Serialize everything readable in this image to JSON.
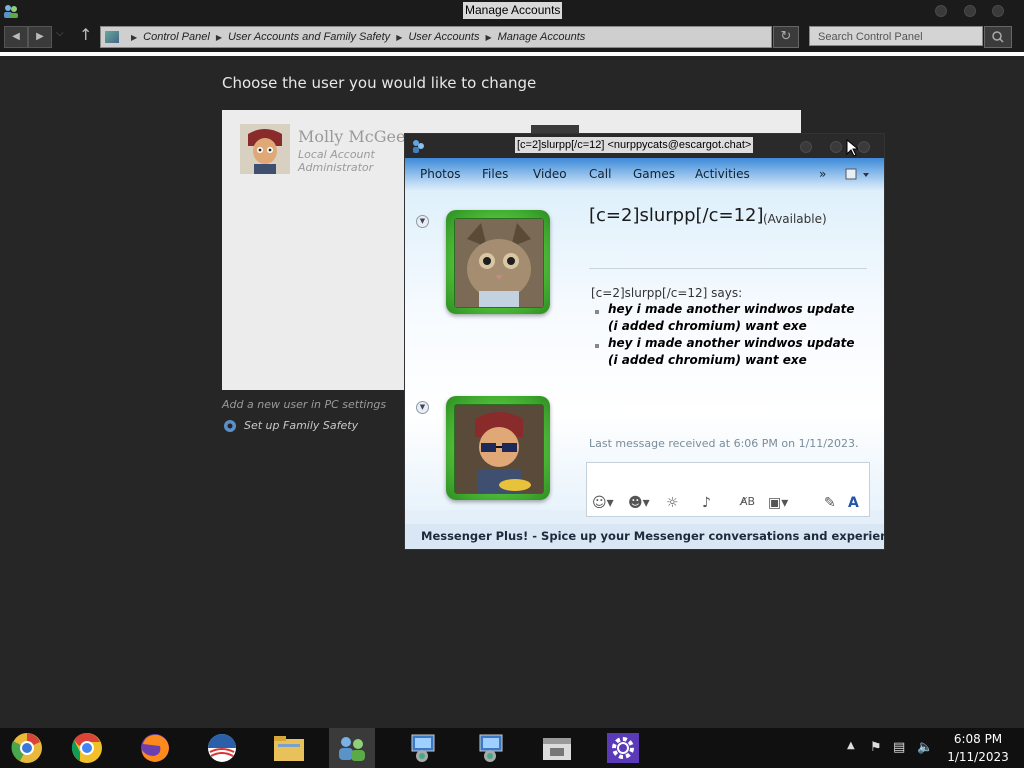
{
  "window": {
    "title": "Manage Accounts"
  },
  "address": {
    "crumbs": [
      "Control Panel",
      "User Accounts and Family Safety",
      "User Accounts",
      "Manage Accounts"
    ],
    "search_placeholder": "Search Control Panel"
  },
  "main": {
    "heading": "Choose the user you would like to change",
    "account": {
      "name": "Molly McGee",
      "type": "Local Account",
      "role": "Administrator"
    },
    "add_user_link": "Add a new user in PC settings",
    "family_safety_link": "Set up Family Safety"
  },
  "messenger": {
    "title": "[c=2]slurpp[/c=12] <nurppycats@escargot.chat>",
    "toolbar": [
      "Photos",
      "Files",
      "Video",
      "Call",
      "Games",
      "Activities"
    ],
    "more_label": "»",
    "contact_name": "[c=2]slurpp[/c=12]",
    "contact_status": "(Available)",
    "says_line": "[c=2]slurpp[/c=12] says:",
    "messages": [
      "hey i made another windwos update (i added chromium) want exe",
      "hey i made another windwos update (i added chromium) want exe"
    ],
    "last_received": "Last message received at 6:06 PM on 1/11/2023.",
    "status_bar": "Messenger Plus! - Spice up your Messenger conversations and experience w..."
  },
  "taskbar": {
    "time": "6:08 PM",
    "date": "1/11/2023"
  },
  "colors": {
    "messenger_accent": "#3d8ad9",
    "frame_green": "#48b534"
  }
}
